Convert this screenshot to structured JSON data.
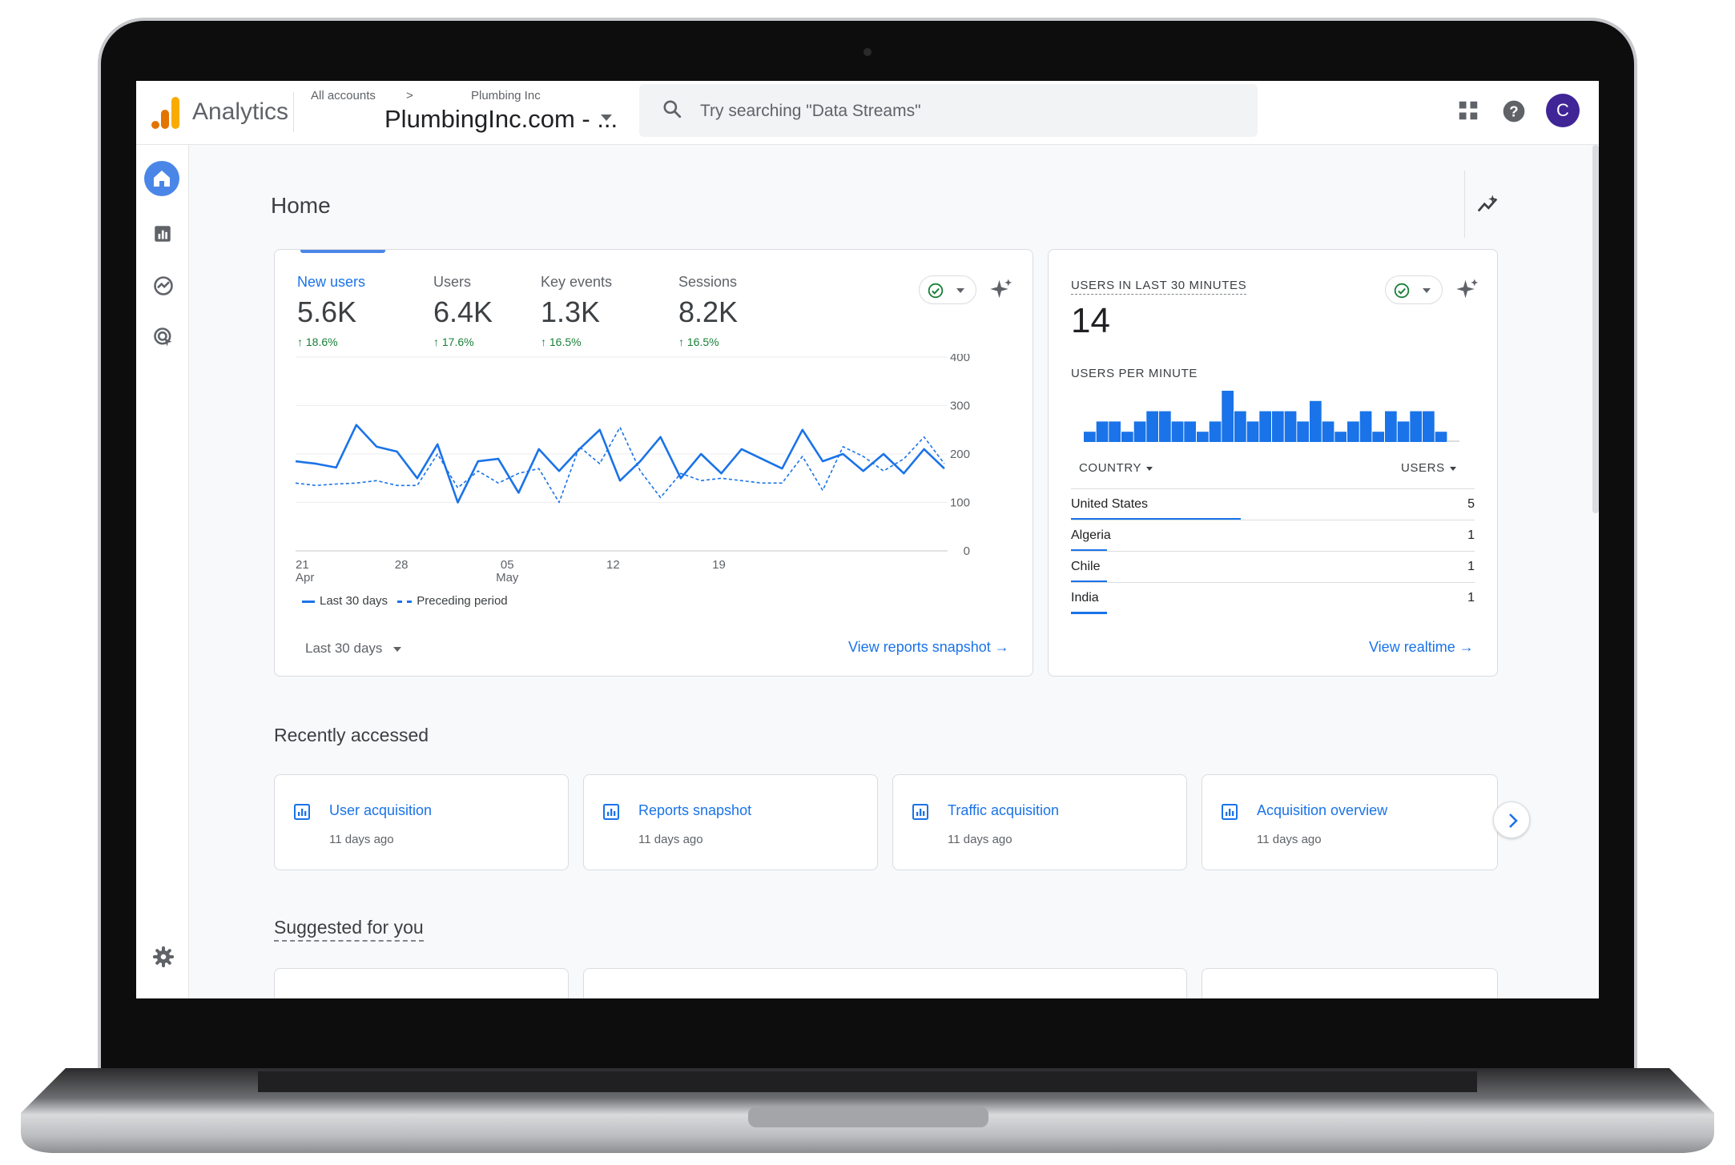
{
  "colors": {
    "accent": "#1a73e8",
    "positive": "#188038",
    "avatar": "#3f2596",
    "home": "#4a86e8",
    "logo_orange": "#f9ab00",
    "logo_dark": "#e37400"
  },
  "header": {
    "app_name": "Analytics",
    "breadcrumb_all": "All accounts",
    "breadcrumb_sep": ">",
    "breadcrumb_account": "Plumbing Inc",
    "property": "PlumbingInc.com - ...",
    "search_placeholder": "Try searching \"Data Streams\"",
    "avatar_initial": "C",
    "icons": [
      "search-icon",
      "apps-grid-icon",
      "help-icon"
    ]
  },
  "rail": {
    "icons": [
      "home-icon",
      "reports-icon",
      "explore-icon",
      "advertising-icon",
      "settings-icon"
    ]
  },
  "page": {
    "title": "Home"
  },
  "overview": {
    "metrics": [
      {
        "label": "New users",
        "value": "5.6K",
        "change": "18.6%"
      },
      {
        "label": "Users",
        "value": "6.4K",
        "change": "17.6%"
      },
      {
        "label": "Key events",
        "value": "1.3K",
        "change": "16.5%"
      },
      {
        "label": "Sessions",
        "value": "8.2K",
        "change": "16.5%"
      }
    ],
    "date_range": "Last 30 days",
    "link": "View reports snapshot"
  },
  "chart_data": {
    "type": "line",
    "x_ticks": [
      [
        "21",
        "Apr"
      ],
      [
        "28",
        ""
      ],
      [
        "05",
        "May"
      ],
      [
        "12",
        ""
      ],
      [
        "19",
        ""
      ]
    ],
    "y_ticks": [
      "400",
      "300",
      "200",
      "100",
      "0"
    ],
    "ylim": [
      0,
      400
    ],
    "grid": true,
    "legend_placement": "bottom-left",
    "series": [
      {
        "name": "Last 30 days",
        "style": "solid",
        "values": [
          185,
          180,
          172,
          260,
          215,
          205,
          150,
          220,
          100,
          185,
          190,
          120,
          210,
          165,
          210,
          250,
          145,
          185,
          235,
          150,
          200,
          160,
          210,
          190,
          170,
          250,
          185,
          200,
          165,
          200,
          160,
          210,
          170
        ]
      },
      {
        "name": "Preceding period",
        "style": "dashed",
        "values": [
          140,
          135,
          138,
          140,
          145,
          135,
          135,
          200,
          130,
          165,
          140,
          160,
          170,
          100,
          215,
          180,
          255,
          165,
          110,
          160,
          145,
          150,
          145,
          140,
          140,
          195,
          125,
          215,
          195,
          165,
          190,
          235,
          180
        ]
      }
    ]
  },
  "realtime": {
    "title": "USERS IN LAST 30 MINUTES",
    "value": "14",
    "per_minute_label": "USERS PER MINUTE",
    "per_minute": [
      1,
      2,
      2,
      1,
      2,
      3,
      3,
      2,
      2,
      1,
      2,
      5,
      3,
      2,
      3,
      3,
      3,
      2,
      4,
      2,
      1,
      2,
      3,
      1,
      3,
      2,
      3,
      3,
      1,
      0
    ],
    "col_country": "COUNTRY",
    "col_users": "USERS",
    "rows": [
      {
        "country": "United States",
        "users": "5",
        "share": 0.42
      },
      {
        "country": "Algeria",
        "users": "1",
        "share": 0.09
      },
      {
        "country": "Chile",
        "users": "1",
        "share": 0.09
      },
      {
        "country": "India",
        "users": "1",
        "share": 0.09
      }
    ],
    "link": "View realtime"
  },
  "recent": {
    "title": "Recently accessed",
    "items": [
      {
        "title": "User acquisition",
        "subtitle": "11 days ago"
      },
      {
        "title": "Reports snapshot",
        "subtitle": "11 days ago"
      },
      {
        "title": "Traffic acquisition",
        "subtitle": "11 days ago"
      },
      {
        "title": "Acquisition overview",
        "subtitle": "11 days ago"
      }
    ]
  },
  "suggested": {
    "title": "Suggested for you"
  }
}
